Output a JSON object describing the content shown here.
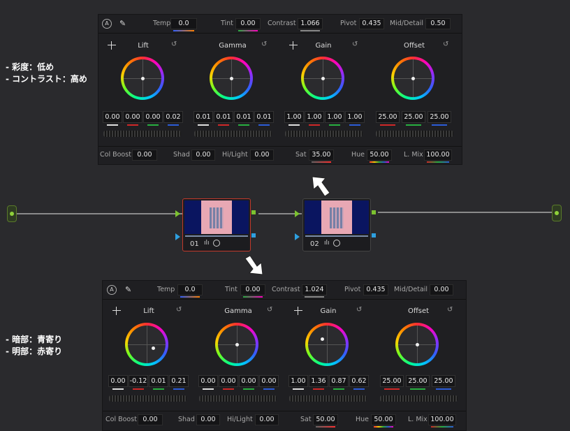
{
  "top_panel": {
    "header": {
      "auto_badge": "A",
      "temp_label": "Temp",
      "temp_value": "0.0",
      "tint_label": "Tint",
      "tint_value": "0.00",
      "contrast_label": "Contrast",
      "contrast_value": "1.066",
      "pivot_label": "Pivot",
      "pivot_value": "0.435",
      "middetail_label": "Mid/Detail",
      "middetail_value": "0.50"
    },
    "wheels": [
      {
        "title": "Lift",
        "values": [
          "0.00",
          "0.00",
          "0.00",
          "0.02"
        ]
      },
      {
        "title": "Gamma",
        "values": [
          "0.01",
          "0.01",
          "0.01",
          "0.01"
        ]
      },
      {
        "title": "Gain",
        "values": [
          "1.00",
          "1.00",
          "1.00",
          "1.00"
        ]
      },
      {
        "title": "Offset",
        "values": [
          "25.00",
          "25.00",
          "25.00"
        ]
      }
    ],
    "footer": {
      "colboost_label": "Col Boost",
      "colboost_value": "0.00",
      "shad_label": "Shad",
      "shad_value": "0.00",
      "hilight_label": "Hi/Light",
      "hilight_value": "0.00",
      "sat_label": "Sat",
      "sat_value": "35.00",
      "hue_label": "Hue",
      "hue_value": "50.00",
      "lmix_label": "L. Mix",
      "lmix_value": "100.00"
    }
  },
  "bottom_panel": {
    "header": {
      "auto_badge": "A",
      "temp_label": "Temp",
      "temp_value": "0.0",
      "tint_label": "Tint",
      "tint_value": "0.00",
      "contrast_label": "Contrast",
      "contrast_value": "1.024",
      "pivot_label": "Pivot",
      "pivot_value": "0.435",
      "middetail_label": "Mid/Detail",
      "middetail_value": "0.00"
    },
    "wheels": [
      {
        "title": "Lift",
        "values": [
          "0.00",
          "-0.12",
          "0.01",
          "0.21"
        ]
      },
      {
        "title": "Gamma",
        "values": [
          "0.00",
          "0.00",
          "0.00",
          "0.00"
        ]
      },
      {
        "title": "Gain",
        "values": [
          "1.00",
          "1.36",
          "0.87",
          "0.62"
        ]
      },
      {
        "title": "Offset",
        "values": [
          "25.00",
          "25.00",
          "25.00"
        ]
      }
    ],
    "footer": {
      "colboost_label": "Col Boost",
      "colboost_value": "0.00",
      "shad_label": "Shad",
      "shad_value": "0.00",
      "hilight_label": "Hi/Light",
      "hilight_value": "0.00",
      "sat_label": "Sat",
      "sat_value": "50.00",
      "hue_label": "Hue",
      "hue_value": "50.00",
      "lmix_label": "L. Mix",
      "lmix_value": "100.00"
    }
  },
  "notes": {
    "top": "- 彩度：低め\n- コントラスト：高め",
    "bottom": "- 暗部：青寄り\n- 明部：赤寄り"
  },
  "nodes": [
    {
      "number": "01"
    },
    {
      "number": "02"
    }
  ],
  "colors": {
    "white_channel": "#e0e0e0",
    "red_channel": "#d02828",
    "green_channel": "#28b040",
    "blue_channel": "#2c5cd8",
    "node_selected_border": "#c0392b",
    "port_green": "#7cc230",
    "port_blue": "#2ea0e0"
  }
}
